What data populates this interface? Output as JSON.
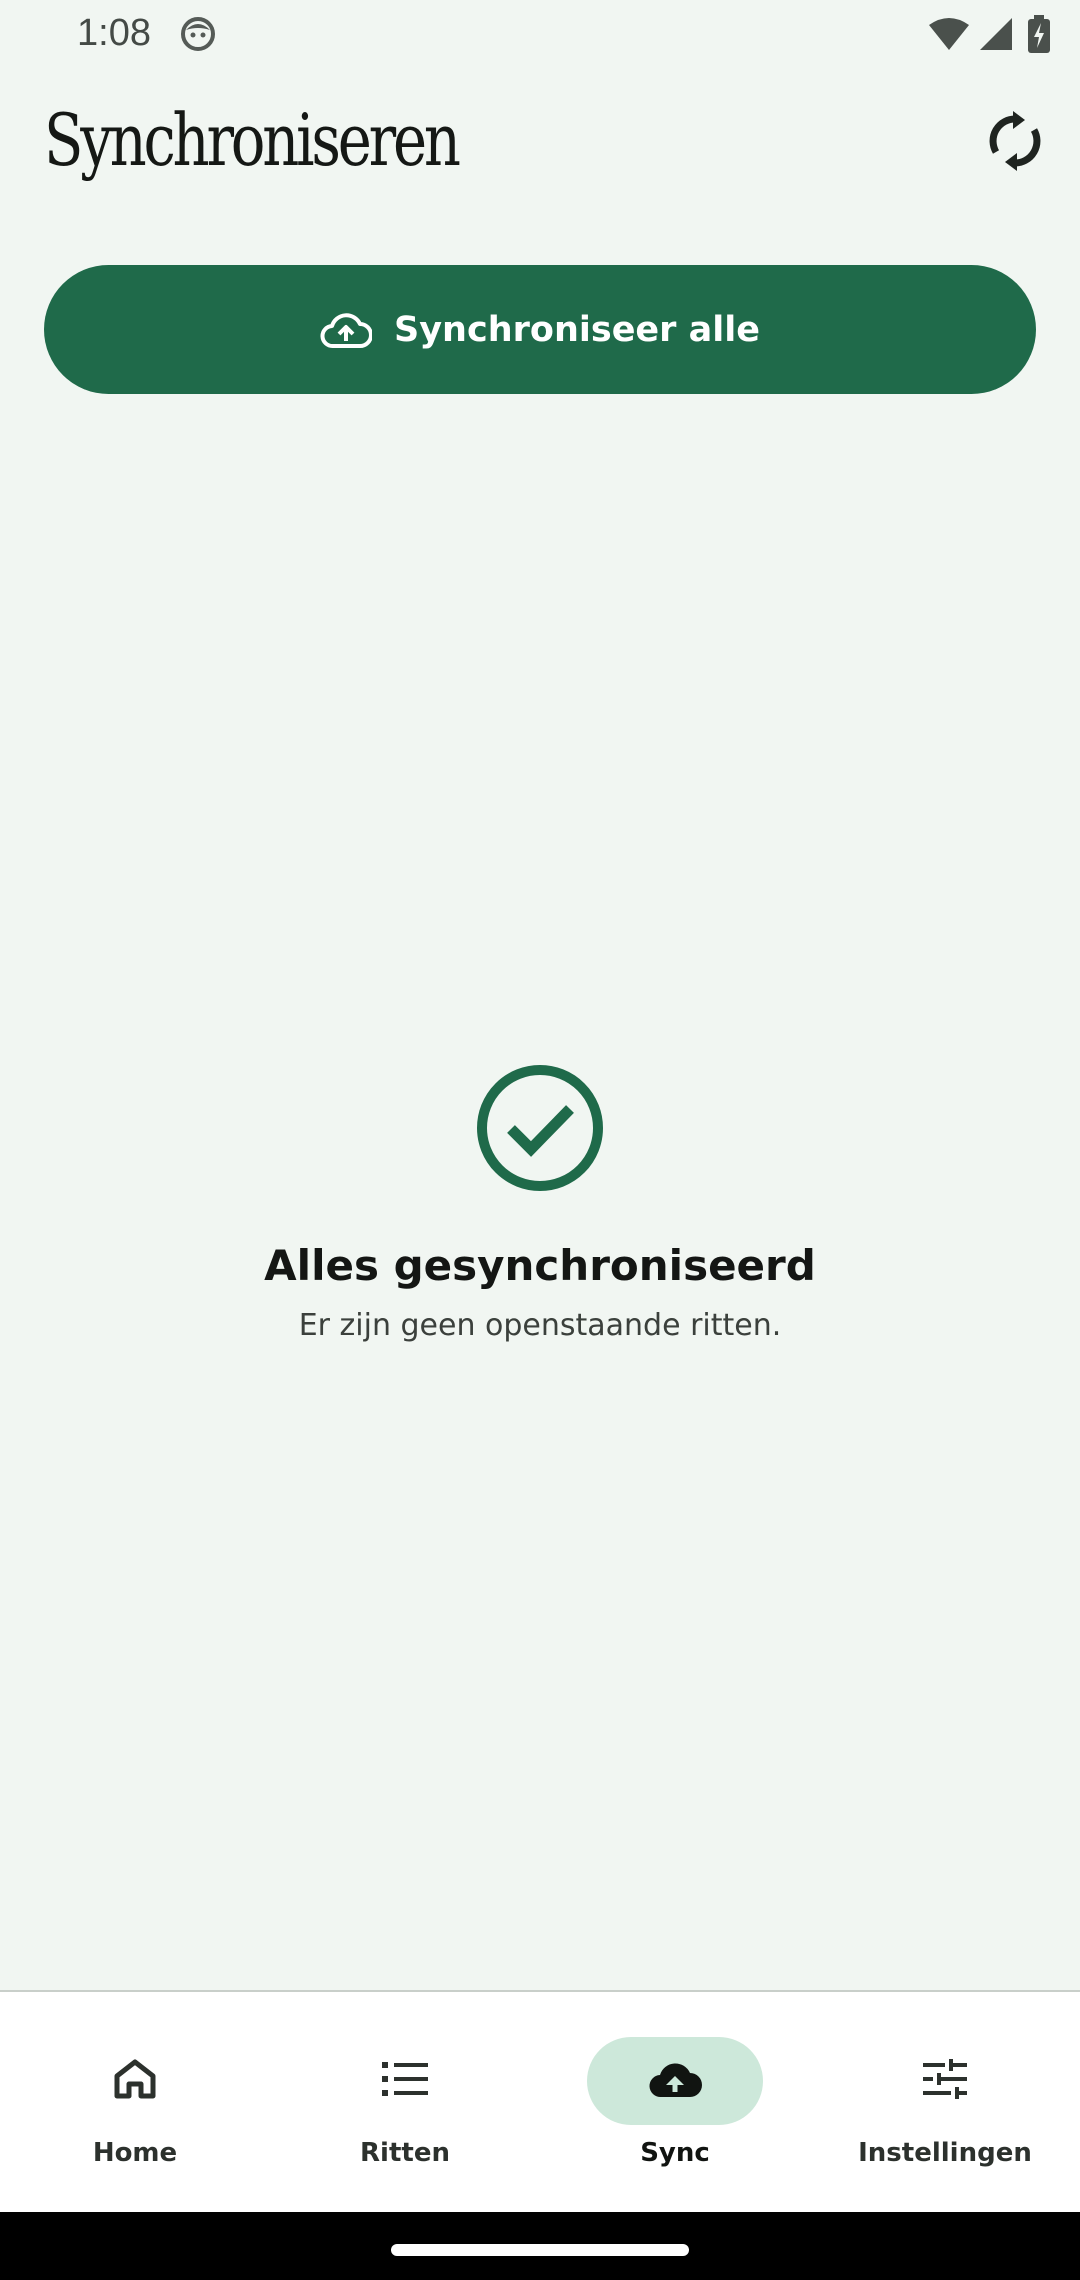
{
  "status_bar": {
    "time": "1:08"
  },
  "header": {
    "title": "Synchroniseren"
  },
  "sync_all": {
    "label": "Synchroniseer alle"
  },
  "empty_state": {
    "title": "Alles gesynchroniseerd",
    "subtitle": "Er zijn geen openstaande ritten."
  },
  "bottom_nav": {
    "items": [
      {
        "label": "Home",
        "icon": "home-icon",
        "active": false
      },
      {
        "label": "Ritten",
        "icon": "list-icon",
        "active": false
      },
      {
        "label": "Sync",
        "icon": "cloud-upload-icon",
        "active": true
      },
      {
        "label": "Instellingen",
        "icon": "tune-icon",
        "active": false
      }
    ]
  },
  "colors": {
    "background": "#f1f6f2",
    "primary": "#1f6a4a",
    "active_indicator": "#cde8da",
    "nav_background": "#ffffff"
  }
}
